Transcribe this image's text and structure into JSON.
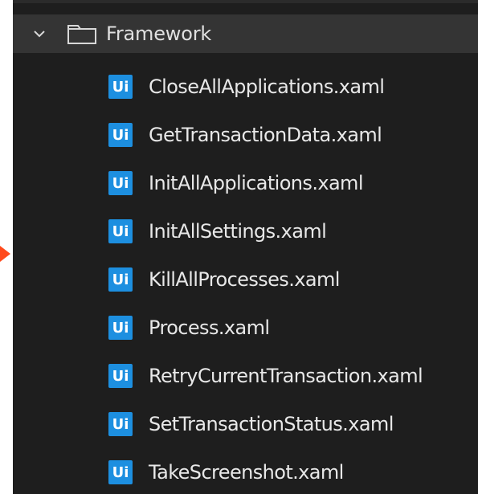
{
  "tree": {
    "folder": {
      "name": "Framework",
      "expanded": true,
      "toggle_icon": "chevron-down-icon",
      "icon": "folder-icon"
    },
    "files": [
      {
        "name": "CloseAllApplications.xaml",
        "badge": "Ui"
      },
      {
        "name": "GetTransactionData.xaml",
        "badge": "Ui"
      },
      {
        "name": "InitAllApplications.xaml",
        "badge": "Ui"
      },
      {
        "name": "InitAllSettings.xaml",
        "badge": "Ui"
      },
      {
        "name": "KillAllProcesses.xaml",
        "badge": "Ui"
      },
      {
        "name": "Process.xaml",
        "badge": "Ui"
      },
      {
        "name": "RetryCurrentTransaction.xaml",
        "badge": "Ui"
      },
      {
        "name": "SetTransactionStatus.xaml",
        "badge": "Ui"
      },
      {
        "name": "TakeScreenshot.xaml",
        "badge": "Ui"
      }
    ]
  },
  "colors": {
    "panel_bg": "#1e1e1e",
    "folder_row_bg": "#343434",
    "badge_bg": "#1d8fe0",
    "text": "#e8e8e8",
    "pointer_arrow": "#ff4a1c"
  }
}
